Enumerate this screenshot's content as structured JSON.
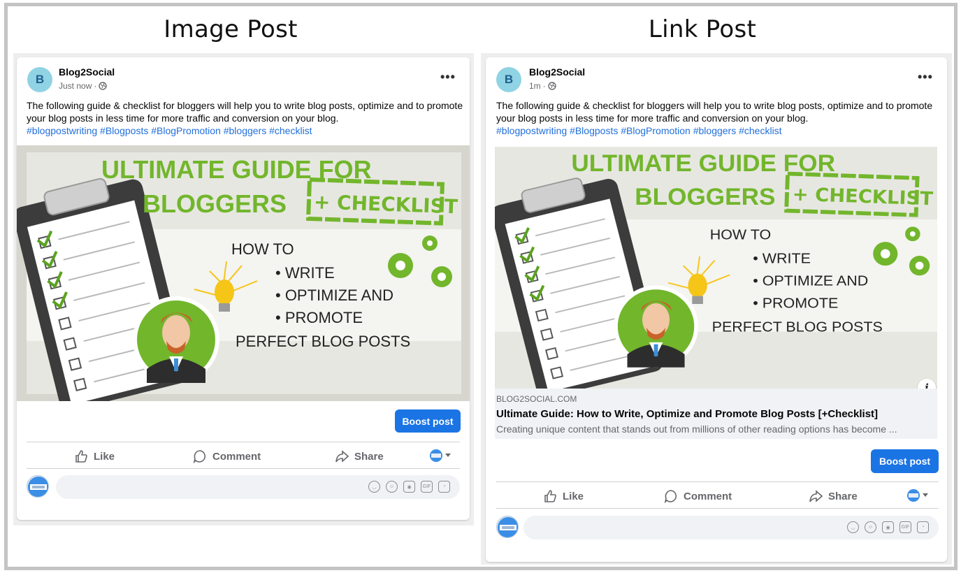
{
  "headings": {
    "left": "Image Post",
    "right": "Link Post"
  },
  "image_post": {
    "author": "Blog2Social",
    "avatar_letter": "B",
    "time": "Just now",
    "more": "•••",
    "text": "The following guide & checklist for bloggers will help you to write blog posts, optimize and to promote your blog posts in less time for more traffic and conversion on your blog.",
    "hashtags": "#blogpostwriting #Blogposts #BlogPromotion #bloggers #checklist",
    "boost_label": "Boost post",
    "actions": {
      "like": "Like",
      "comment": "Comment",
      "share": "Share"
    }
  },
  "link_post": {
    "author": "Blog2Social",
    "avatar_letter": "B",
    "time": "1m",
    "more": "•••",
    "text": "The following guide & checklist for bloggers will help you to write blog posts, optimize and to promote your blog posts in less time for more traffic and conversion on your blog.",
    "hashtags": "#blogpostwriting #Blogposts #BlogPromotion #bloggers #checklist",
    "link_domain": "BLOG2SOCIAL.COM",
    "link_title": "Ultimate Guide: How to Write, Optimize and Promote Blog Posts [+Checklist]",
    "link_desc": "Creating unique content that stands out from millions of other reading options has become ...",
    "info": "i",
    "boost_label": "Boost post",
    "actions": {
      "like": "Like",
      "comment": "Comment",
      "share": "Share"
    }
  },
  "graphic": {
    "line1": "ULTIMATE GUIDE FOR",
    "line2": "BLOGGERS",
    "stamp": "+ CHECKLIST",
    "howto": "HOW TO",
    "b1": "• WRITE",
    "b2": "• OPTIMIZE AND",
    "b3": "• PROMOTE",
    "last": "PERFECT BLOG POSTS"
  },
  "comment_icons": [
    "GIF"
  ],
  "colors": {
    "brand_blue": "#1b74e4",
    "hashtag": "#216fdb",
    "graphic_green": "#72b62c"
  }
}
